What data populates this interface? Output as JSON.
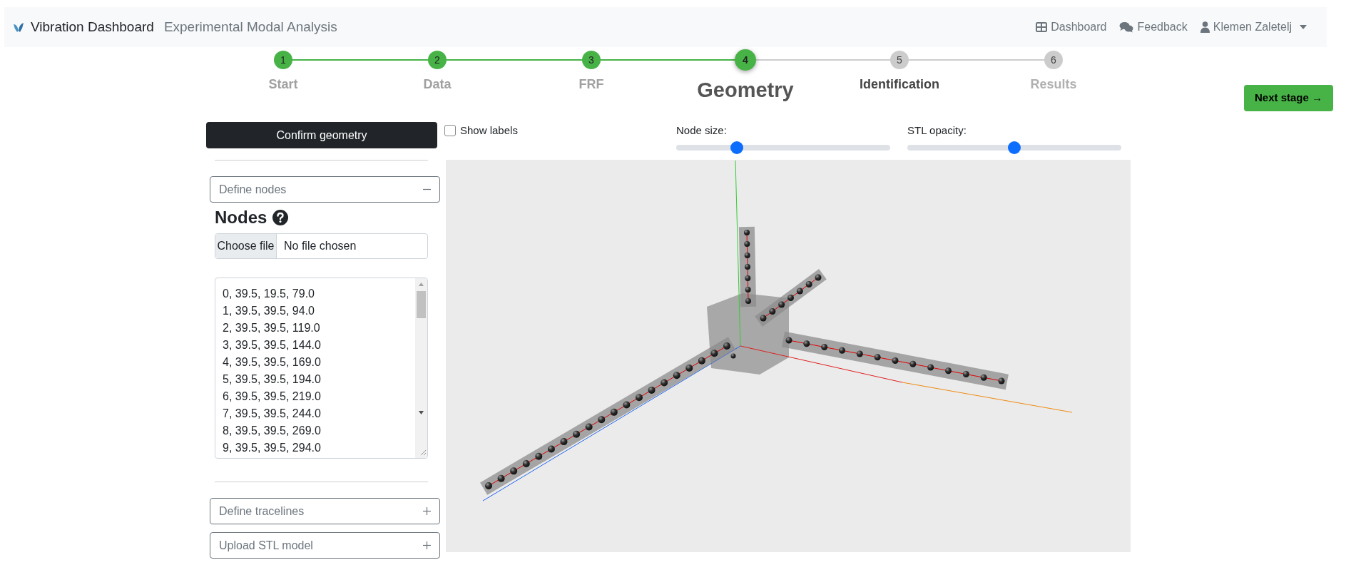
{
  "navbar": {
    "brand": "Vibration Dashboard",
    "subtitle": "Experimental Modal Analysis",
    "links": [
      {
        "kind": "dashboard",
        "label": "Dashboard"
      },
      {
        "kind": "feedback",
        "label": "Feedback"
      },
      {
        "kind": "user",
        "label": "Klemen Zaletelj"
      }
    ]
  },
  "stepper": [
    {
      "number": "1",
      "label": "Start",
      "completed": true,
      "selected": false,
      "enabled": true
    },
    {
      "number": "2",
      "label": "Data",
      "completed": true,
      "selected": false,
      "enabled": true
    },
    {
      "number": "3",
      "label": "FRF",
      "completed": true,
      "selected": false,
      "enabled": true
    },
    {
      "number": "4",
      "label": "Geometry",
      "completed": true,
      "selected": true,
      "enabled": true
    },
    {
      "number": "5",
      "label": "Identification",
      "completed": false,
      "selected": false,
      "enabled": true
    },
    {
      "number": "6",
      "label": "Results",
      "completed": false,
      "selected": false,
      "enabled": false
    }
  ],
  "next_button": "Next stage →",
  "confirm_button": "Confirm geometry",
  "sections": [
    {
      "title": "Define nodes",
      "expanded": true,
      "body": {
        "heading": "Nodes",
        "file_button": "Choose file",
        "file_status": "No file chosen",
        "text": "0, 39.5, 19.5, 79.0\n1, 39.5, 39.5, 94.0\n2, 39.5, 39.5, 119.0\n3, 39.5, 39.5, 144.0\n4, 39.5, 39.5, 169.0\n5, 39.5, 39.5, 194.0\n6, 39.5, 39.5, 219.0\n7, 39.5, 39.5, 244.0\n8, 39.5, 39.5, 269.0\n9, 39.5, 39.5, 294.0"
      }
    },
    {
      "title": "Define tracelines",
      "expanded": false
    },
    {
      "title": "Upload STL model",
      "expanded": false
    }
  ],
  "show_labels": {
    "label": "Show labels",
    "checked": false
  },
  "sliders": [
    {
      "label": "Node size:",
      "level": 0.27
    },
    {
      "label": "STL opacity:",
      "level": 0.5
    }
  ]
}
